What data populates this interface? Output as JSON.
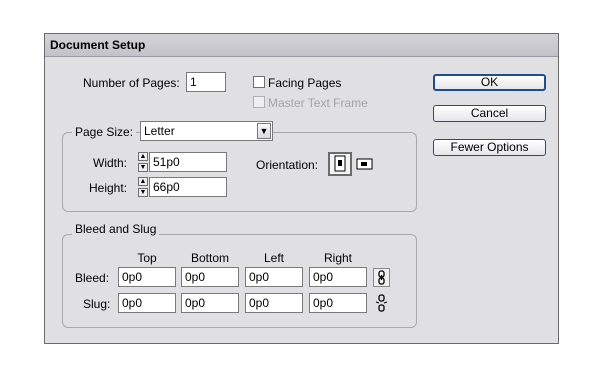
{
  "dialog": {
    "title": "Document Setup"
  },
  "pages": {
    "label": "Number of Pages:",
    "value": "1"
  },
  "facing_pages": {
    "label": "Facing Pages",
    "checked": false
  },
  "master_text_frame": {
    "label": "Master Text Frame",
    "checked": false,
    "enabled": false
  },
  "buttons": {
    "ok": "OK",
    "cancel": "Cancel",
    "fewer_options": "Fewer Options"
  },
  "page_size": {
    "label": "Page Size:",
    "selected": "Letter",
    "width_label": "Width:",
    "width_value": "51p0",
    "height_label": "Height:",
    "height_value": "66p0",
    "orientation_label": "Orientation:"
  },
  "bleed_slug": {
    "group_label": "Bleed and Slug",
    "columns": [
      "Top",
      "Bottom",
      "Left",
      "Right"
    ],
    "bleed_label": "Bleed:",
    "bleed_values": [
      "0p0",
      "0p0",
      "0p0",
      "0p0"
    ],
    "slug_label": "Slug:",
    "slug_values": [
      "0p0",
      "0p0",
      "0p0",
      "0p0"
    ]
  }
}
